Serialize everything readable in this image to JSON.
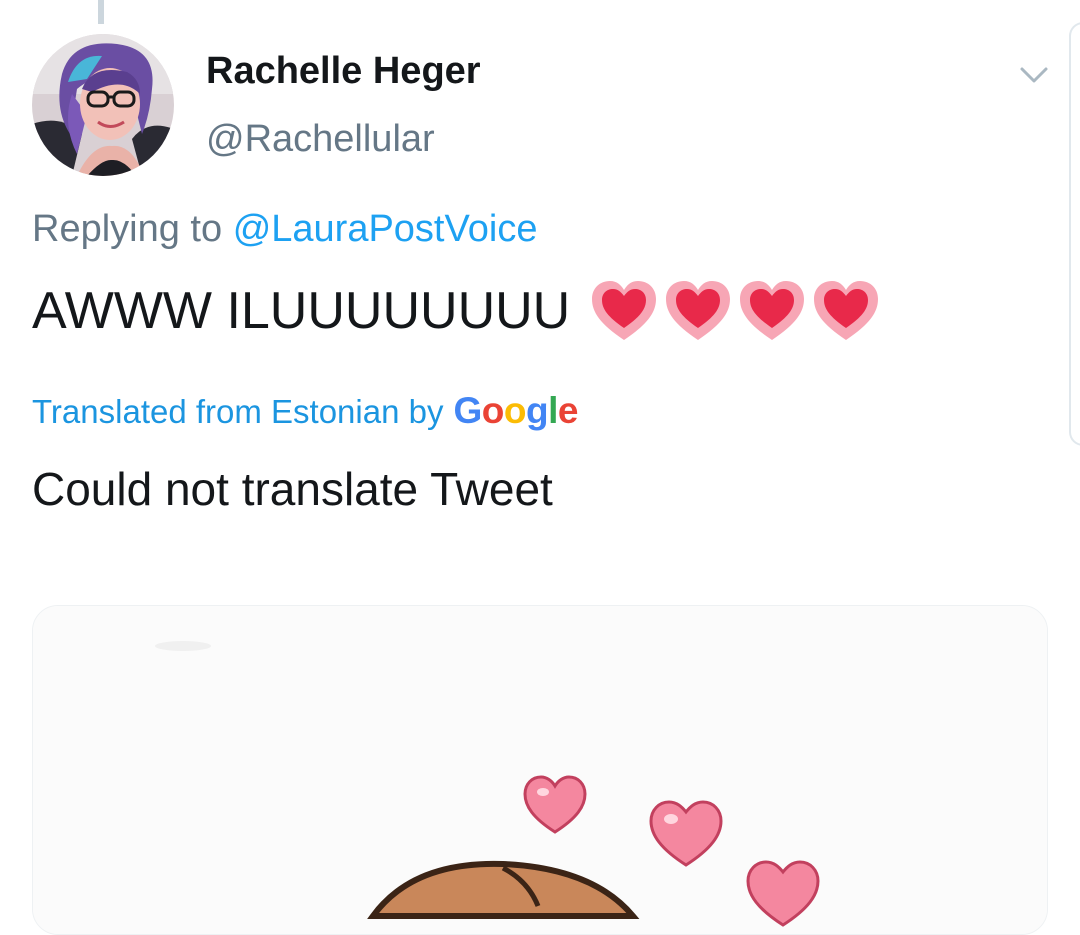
{
  "tweet": {
    "author": {
      "display_name": "Rachelle Heger",
      "handle": "@Rachellular",
      "avatar": "avatar-photo"
    },
    "reply": {
      "prefix": "Replying to",
      "mention": "@LauraPostVoice"
    },
    "text": "AWWW ILUUUUUUUU",
    "emoji": [
      "heart-emoji",
      "heart-emoji",
      "heart-emoji",
      "heart-emoji"
    ],
    "translation": {
      "label": "Translated from Estonian by",
      "provider": "Google",
      "status": "Could not translate Tweet"
    },
    "media": {
      "type": "animated-gif",
      "icon": "hearts-character-illustration"
    },
    "menu_icon": "chevron-down-icon"
  },
  "colors": {
    "text_primary": "#14171a",
    "text_secondary": "#657786",
    "link": "#1da1f2",
    "translate_link": "#1b95e0",
    "google_blue": "#4285F4",
    "google_red": "#EA4335",
    "google_yellow": "#FBBC05",
    "google_green": "#34A853",
    "heart_red": "#e8294a",
    "heart_pink": "#f7a6b5"
  }
}
